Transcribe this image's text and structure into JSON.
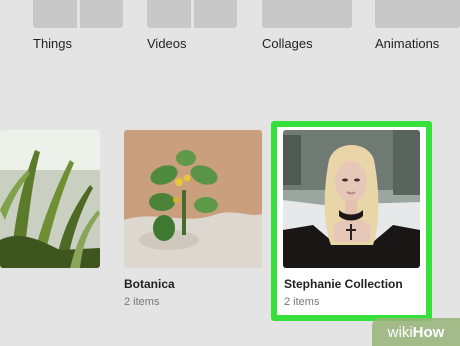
{
  "categories": [
    {
      "label": "Things"
    },
    {
      "label": "Videos"
    },
    {
      "label": "Collages"
    },
    {
      "label": "Animations"
    }
  ],
  "albums": [
    {
      "title": "Botanica",
      "count": "2 items"
    },
    {
      "title": "Stephanie Collection",
      "count": "2 items",
      "selected": true
    }
  ],
  "watermark": {
    "part1": "wiki",
    "part2": "How"
  },
  "colors": {
    "selection": "#35e03a",
    "background": "#e4e4e4"
  }
}
